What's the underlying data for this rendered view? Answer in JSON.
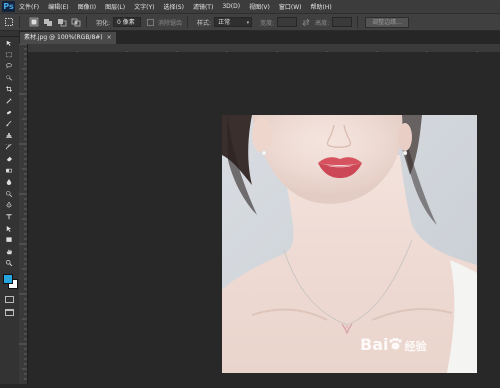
{
  "app": {
    "logo": "Ps"
  },
  "menu": [
    "文件(F)",
    "编辑(E)",
    "图像(I)",
    "图层(L)",
    "文字(Y)",
    "选择(S)",
    "滤镜(T)",
    "3D(D)",
    "视图(V)",
    "窗口(W)",
    "帮助(H)"
  ],
  "options": {
    "feather_label": "羽化:",
    "feather_value": "0 像素",
    "antialias_label": "消除锯齿",
    "style_label": "样式:",
    "style_value": "正常",
    "width_label": "宽度:",
    "height_label": "高度:",
    "refine_button": "调整边缘..."
  },
  "document": {
    "tab_title": "素材.jpg @ 100%(RGB/8#)",
    "close_glyph": "×"
  },
  "watermark": {
    "brand": "Bai",
    "suffix": "经验"
  },
  "tools": [
    "move-tool-icon",
    "marquee-tool-icon",
    "lasso-tool-icon",
    "quick-select-tool-icon",
    "crop-tool-icon",
    "eyedropper-tool-icon",
    "healing-brush-tool-icon",
    "brush-tool-icon",
    "clone-stamp-tool-icon",
    "history-brush-tool-icon",
    "eraser-tool-icon",
    "gradient-tool-icon",
    "blur-tool-icon",
    "dodge-tool-icon",
    "pen-tool-icon",
    "type-tool-icon",
    "path-select-tool-icon",
    "shape-tool-icon",
    "hand-tool-icon",
    "zoom-tool-icon"
  ],
  "colors": {
    "accent": "#2d9ad6",
    "foreground": "#27a5de",
    "background": "#ffffff"
  }
}
